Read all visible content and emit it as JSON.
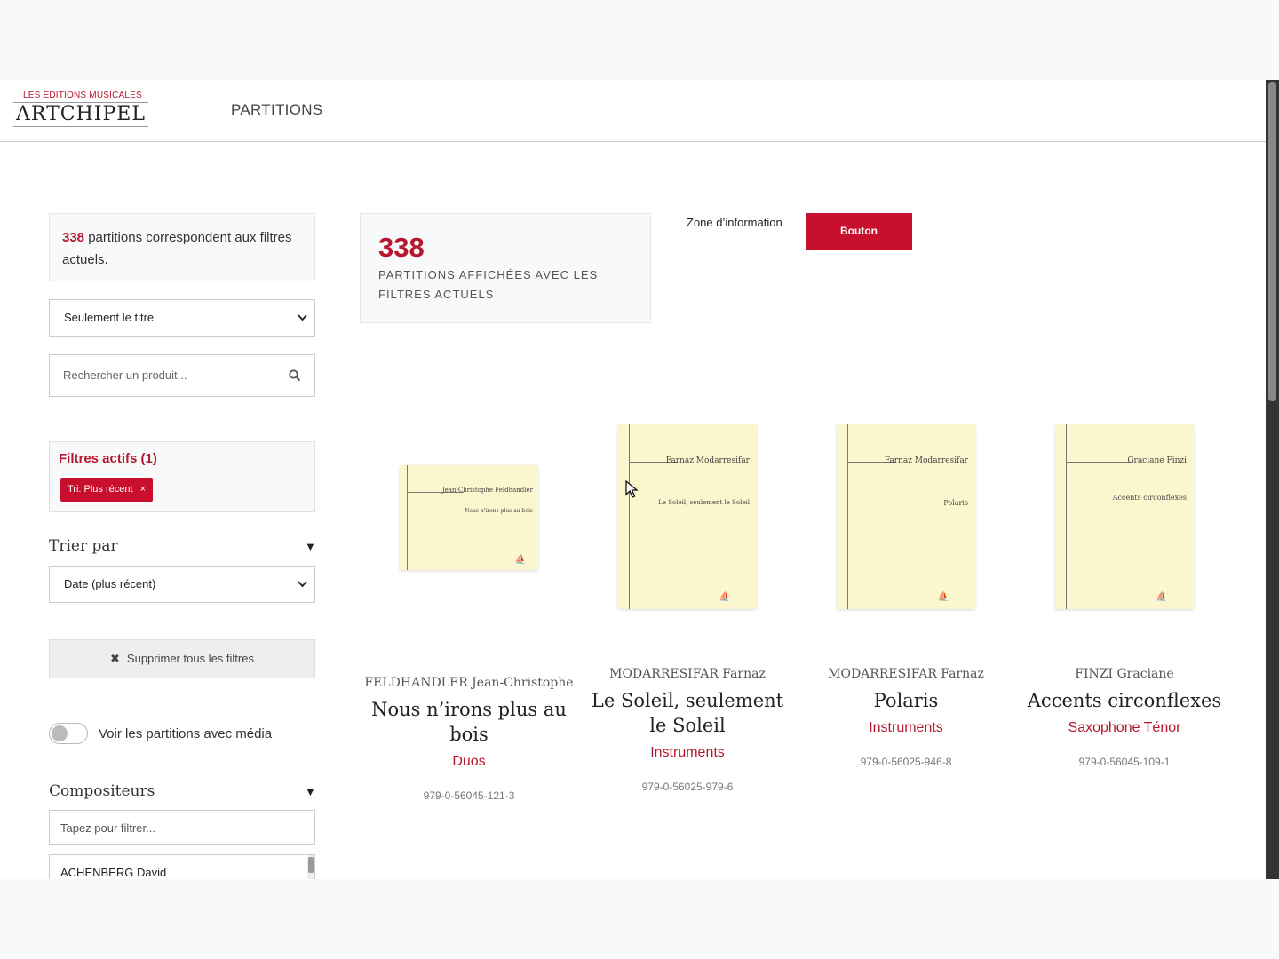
{
  "header": {
    "logo_top": "LES EDITIONS MUSICALES",
    "logo_main": "ARTCHIPEL",
    "nav_label": "PARTITIONS"
  },
  "sidebar": {
    "count_number": "338",
    "count_text": " partitions correspondent aux filtres actuels.",
    "search_scope": "Seulement le titre",
    "search_placeholder": "Rechercher un produit...",
    "active_filters_title": "Filtres actifs (1)",
    "active_filter_chip": "Tri: Plus récent",
    "chip_remove": "×",
    "sort_title": "Trier par",
    "sort_value": "Date (plus récent)",
    "clear_label": "Supprimer tous les filtres",
    "media_toggle_label": "Voir les partitions avec média",
    "composers_title": "Compositeurs",
    "composers_placeholder": "Tapez pour filtrer...",
    "composers_first": "ACHENBERG David",
    "arrow": "▼"
  },
  "main": {
    "stat_number": "338",
    "stat_label": "PARTITIONS AFFICHÉES AVEC LES FILTRES ACTUELS",
    "info_text": "Zone d’information",
    "info_button": "Bouton"
  },
  "products": [
    {
      "composer": "FELDHANDLER Jean-Christophe",
      "title": "Nous n’irons plus au bois",
      "category": "Duos",
      "isbn": "979-0-56045-121-3",
      "cover_author": "Jean-Christophe Feldhandler",
      "cover_title": "Nous n'irons plus au bois"
    },
    {
      "composer": "MODARRESIFAR Farnaz",
      "title": "Le Soleil, seulement le Soleil",
      "category": "Instruments",
      "isbn": "979-0-56025-979-6",
      "cover_author": "Farnaz Modarresifar",
      "cover_title": "Le Soleil, seulement le Soleil"
    },
    {
      "composer": "MODARRESIFAR Farnaz",
      "title": "Polaris",
      "category": "Instruments",
      "isbn": "979-0-56025-946-8",
      "cover_author": "Farnaz Modarresifar",
      "cover_title": "Polaris"
    },
    {
      "composer": "FINZI Graciane",
      "title": "Accents circonflexes",
      "category": "Saxophone Ténor",
      "isbn": "979-0-56045-109-1",
      "cover_author": "Graciane Finzi",
      "cover_title": "Accents circonflexes"
    }
  ],
  "icons": {
    "search": "search-icon",
    "close": "close-icon",
    "chevron": "chevron-down-icon"
  },
  "colors": {
    "accent": "#c8102e",
    "accent_text": "#b5172f",
    "cover": "#fbf6cd"
  }
}
